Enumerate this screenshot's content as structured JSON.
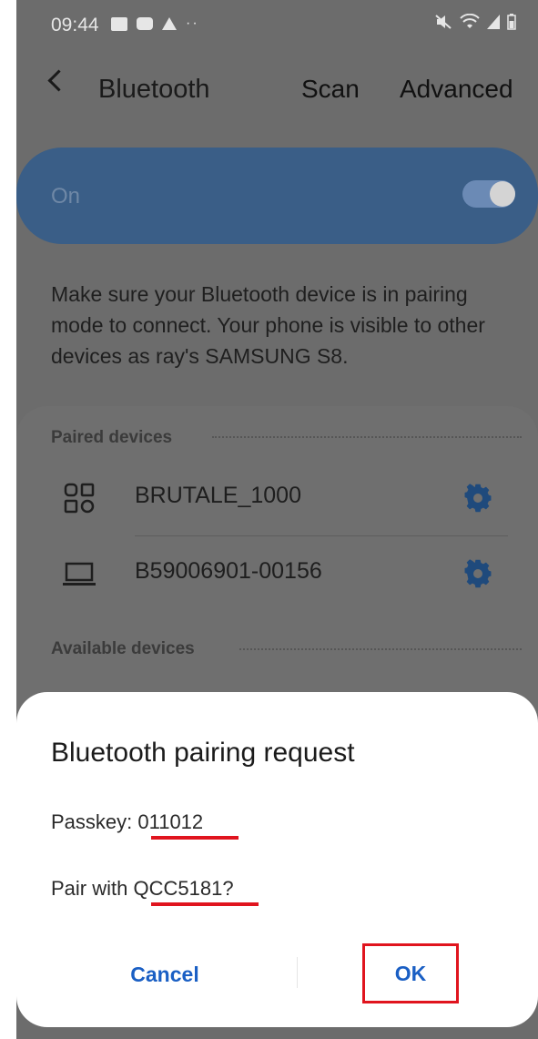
{
  "status_bar": {
    "time": "09:44",
    "left_icons": [
      "gallery-icon",
      "youtube-icon",
      "warning-icon",
      "more-dots-icon"
    ],
    "right_icons": [
      "mute-icon",
      "wifi-icon",
      "signal-icon",
      "battery-icon"
    ]
  },
  "header": {
    "title": "Bluetooth",
    "scan_label": "Scan",
    "advanced_label": "Advanced"
  },
  "toggle": {
    "label": "On",
    "state": "on"
  },
  "info_text": "Make sure your Bluetooth device is in pairing mode to connect. Your phone is visible to other devices as ray's SAMSUNG S8.",
  "paired": {
    "header": "Paired devices",
    "devices": [
      {
        "name": "BRUTALE_1000",
        "icon": "generic-device-icon"
      },
      {
        "name": "B59006901-00156",
        "icon": "laptop-icon"
      }
    ]
  },
  "available": {
    "header": "Available devices"
  },
  "dialog": {
    "title": "Bluetooth pairing request",
    "passkey_label": "Passkey: ",
    "passkey_value": "011012",
    "pair_label": "Pair with ",
    "pair_device": "QCC5181",
    "pair_suffix": "?",
    "cancel_label": "Cancel",
    "ok_label": "OK"
  },
  "colors": {
    "accent_blue": "#1a5fc4",
    "highlight_red": "#e0141e"
  }
}
